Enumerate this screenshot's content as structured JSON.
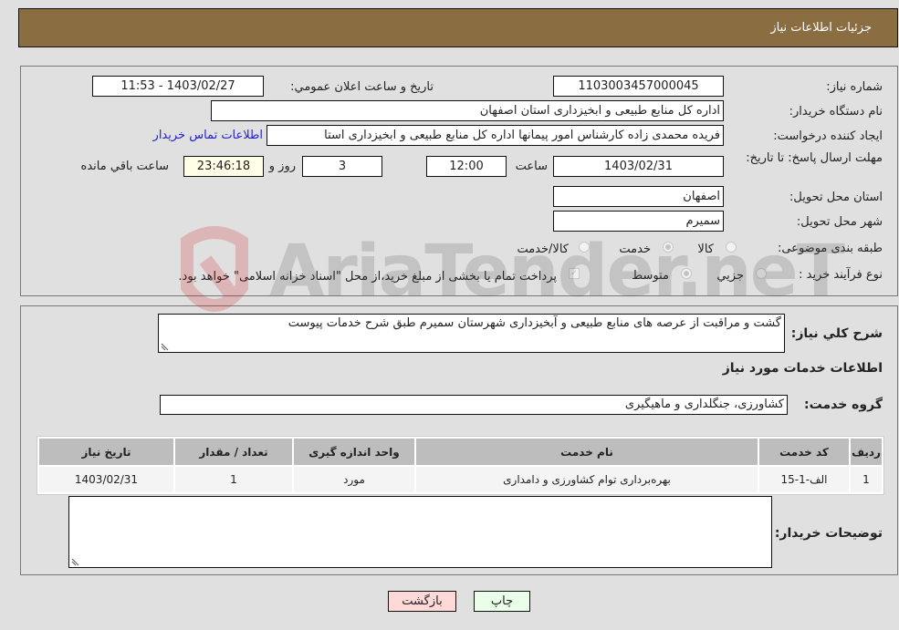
{
  "header": {
    "title": "جزئیات اطلاعات نیاز"
  },
  "form": {
    "need_number_label": "شماره نیاز:",
    "need_number": "1103003457000045",
    "announce_label": "تاريخ و ساعت اعلان عمومي:",
    "announce_value": "1403/02/27 - 11:53",
    "buyer_org_label": "نام دستگاه خریدار:",
    "buyer_org": "اداره کل منابع طبیعی و ابخیزداری استان اصفهان",
    "creator_label": "ایجاد کننده درخواست:",
    "creator": "فریده محمدی زاده کارشناس امور پیمانها اداره کل منابع طبیعی و ابخیزداری استا",
    "contact_link": "اطلاعات تماس خریدار",
    "deadline_label": "مهلت ارسال پاسخ: تا تاریخ:",
    "deadline_date": "1403/02/31",
    "time_label": "ساعت",
    "deadline_time": "12:00",
    "days_value": "3",
    "days_label": "روز و",
    "remaining_time": "23:46:18",
    "remaining_label": "ساعت باقي مانده",
    "province_label": "استان محل تحویل:",
    "province": "اصفهان",
    "city_label": "شهر محل تحویل:",
    "city": "سمیرم",
    "category_label": "طبقه بندی موضوعی:",
    "category_options": [
      "کالا",
      "خدمت",
      "کالا/خدمت"
    ],
    "category_selected": "خدمت",
    "process_label": "نوع فرآیند خرید :",
    "process_options": [
      "جزيي",
      "متوسط"
    ],
    "process_selected": "متوسط",
    "treasury_note": "پرداخت تمام یا بخشی از مبلغ خرید،از محل \"اسناد خزانه اسلامی\" خواهد بود."
  },
  "details": {
    "summary_label": "شرح كلي نياز:",
    "summary": "گشت و مراقبت از عرصه های منابع طبیعی و آبخیزداری شهرستان سمیرم طبق شرح خدمات پیوست",
    "services_heading": "اطلاعات خدمات مورد نياز",
    "service_group_label": "گروه خدمت:",
    "service_group": "کشاورزی، جنگلداری و ماهیگیری",
    "table": {
      "headers": [
        "رديف",
        "كد خدمت",
        "نام خدمت",
        "واحد اندازه گيری",
        "تعداد / مقدار",
        "تاريخ نياز"
      ],
      "rows": [
        [
          "1",
          "الف-1-15",
          "بهره‌برداری توام کشاورزی و دامداری",
          "مورد",
          "1",
          "1403/02/31"
        ]
      ]
    },
    "buyer_notes_label": "توضيحات خريدار:",
    "buyer_notes": ""
  },
  "buttons": {
    "print": "چاپ",
    "back": "بازگشت"
  },
  "watermark": {
    "text": "AriaTender.neT"
  }
}
